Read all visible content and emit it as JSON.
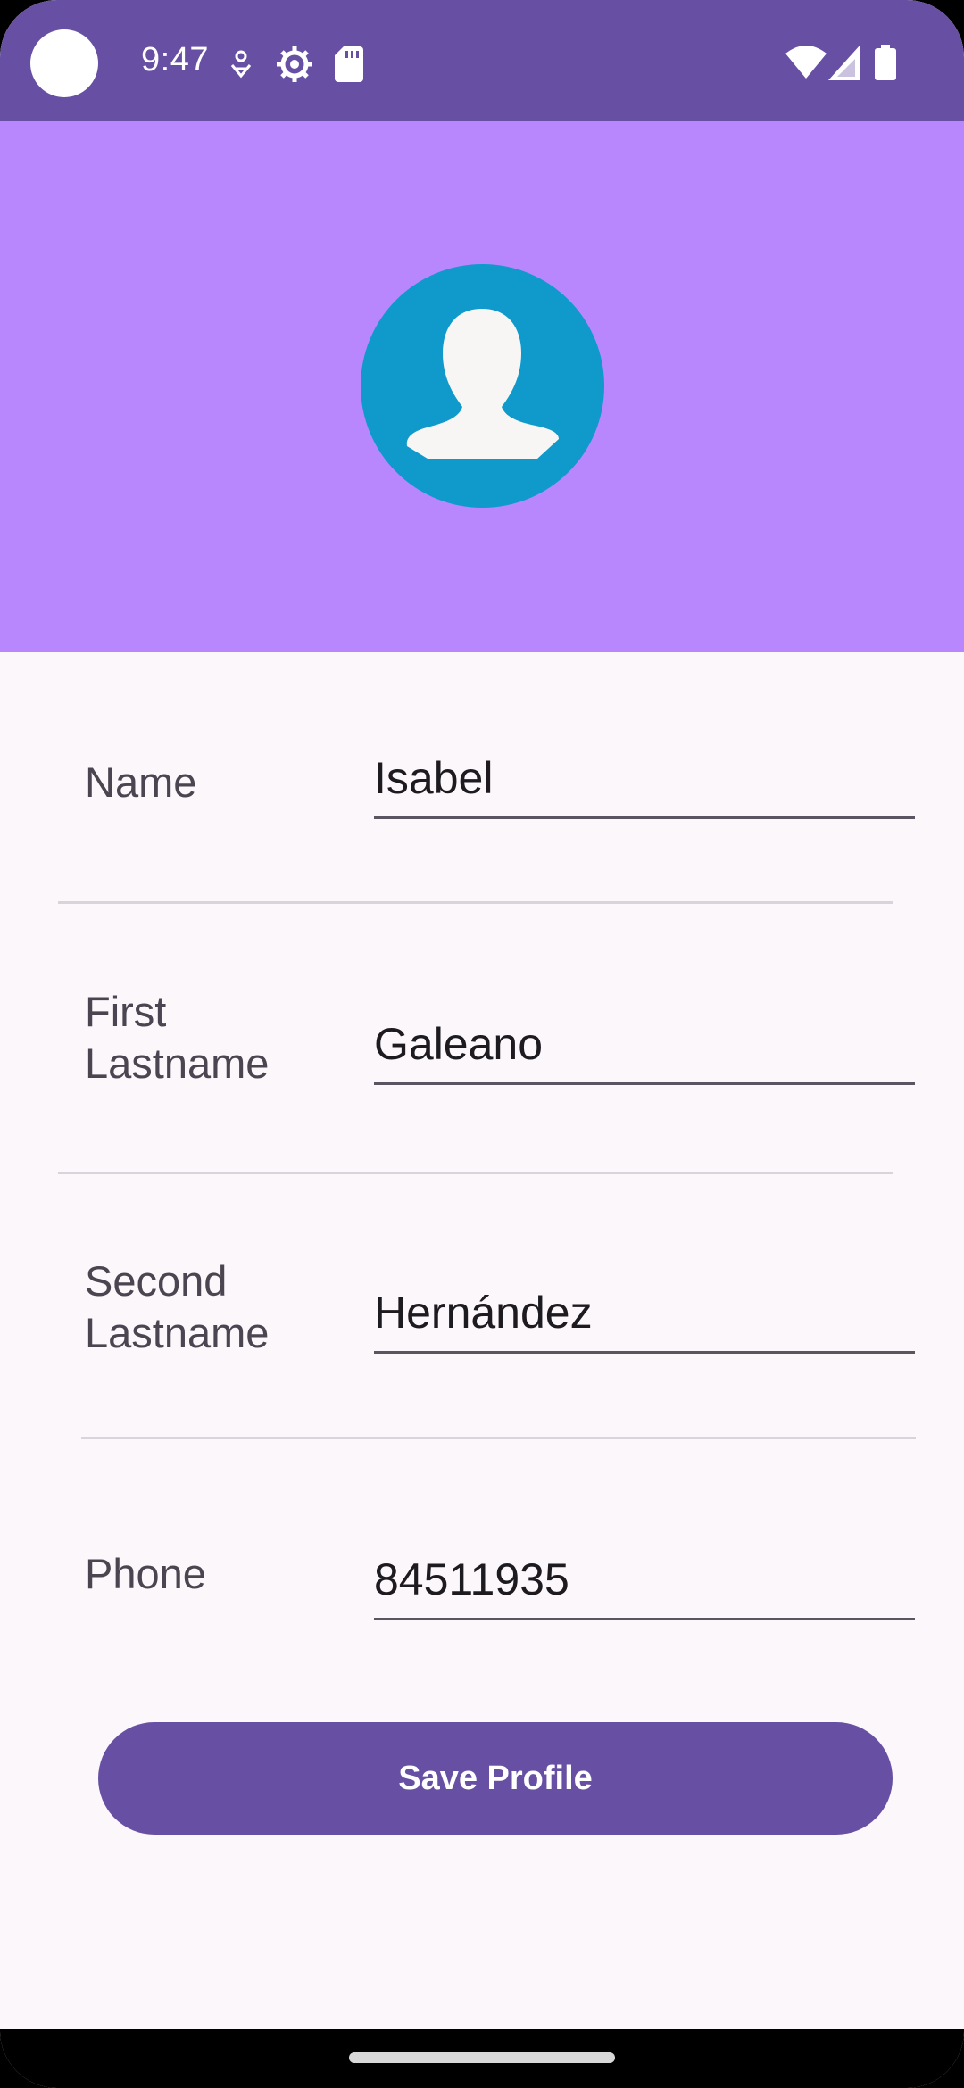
{
  "status_bar": {
    "time": "9:47",
    "icons": [
      "notification-dot-icon",
      "settings-gear-icon",
      "sd-card-icon",
      "wifi-icon",
      "signal-icon",
      "battery-icon"
    ]
  },
  "colors": {
    "status_bar": "#6750a4",
    "header": "#b886fd",
    "avatar_background": "#0f9acb",
    "button": "#6750a4",
    "page_background": "#fcf7fb"
  },
  "profile": {
    "avatar_icon": "person-icon",
    "fields": [
      {
        "label": "Name",
        "value": "Isabel"
      },
      {
        "label": "First\nLastname",
        "value": "Galeano"
      },
      {
        "label": "Second\nLastname",
        "value": "Hernández"
      },
      {
        "label": "Phone",
        "value": "84511935"
      }
    ]
  },
  "actions": {
    "save_label": "Save Profile"
  }
}
